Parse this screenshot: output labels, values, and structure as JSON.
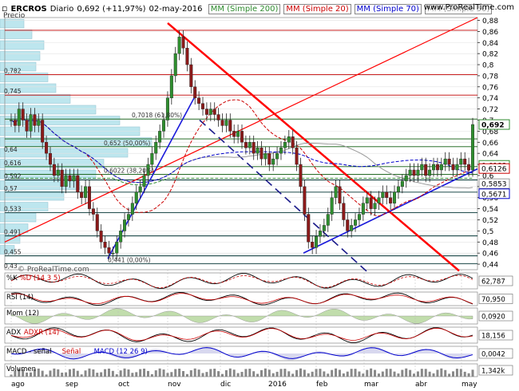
{
  "header": {
    "symbol": "ERCROS",
    "period": "Diario",
    "last": "0,692 (+11,97%)",
    "date": "02-may-2016",
    "ma200": "MM (Simple 200)",
    "ma20": "MM (Simple 20)",
    "ma70": "MM (Simple 70)",
    "ma50": "MM (Simple 50)",
    "site": "www.ProRealTime.com"
  },
  "colors": {
    "ma200": "#2e8b2e",
    "ma20": "#cc0000",
    "ma70": "#0000cc",
    "ma50": "#999999",
    "trend_red": "#ff0000",
    "trend_blue": "#1a1adb",
    "candle_up": "#2f8f2f",
    "candle_down": "#8b1a1a",
    "volume_profile": "#bde6ee"
  },
  "chart_data": {
    "type": "candlestick",
    "price_label": "Precio",
    "watermark": "© ProRealTime.com",
    "y_ticks": [
      "0,88",
      "0,86",
      "0,84",
      "0,82",
      "0,8",
      "0,78",
      "0,76",
      "0,74",
      "0,72",
      "0,7",
      "0,68",
      "0,66",
      "0,64",
      "0,62",
      "0,6",
      "0,58",
      "0,56",
      "0,54",
      "0,52",
      "0,5",
      "0,48",
      "0,46",
      "0,44"
    ],
    "ylim": [
      0.43,
      0.885
    ],
    "x_labels": [
      "ago",
      "sep",
      "oct",
      "nov",
      "dic",
      "2016",
      "feb",
      "mar",
      "abr",
      "may"
    ],
    "fib_labels": [
      {
        "text": "0,7018 (61,80%)",
        "value": 0.7018
      },
      {
        "text": "0,652 (50,00%)",
        "value": 0.652
      },
      {
        "text": "0,6022 (38,20%)",
        "value": 0.6022
      },
      {
        "text": "0,441 (0,00%)",
        "value": 0.441
      }
    ],
    "left_levels": [
      {
        "text": "0,782",
        "value": 0.782
      },
      {
        "text": "0,745",
        "value": 0.745
      },
      {
        "text": "0,64",
        "value": 0.64
      },
      {
        "text": "0,616",
        "value": 0.616
      },
      {
        "text": "0,592",
        "value": 0.592
      },
      {
        "text": "0,57",
        "value": 0.57
      },
      {
        "text": "0,533",
        "value": 0.533
      },
      {
        "text": "0,491",
        "value": 0.491
      },
      {
        "text": "0,455",
        "value": 0.455
      },
      {
        "text": "0,43",
        "value": 0.43
      }
    ],
    "horizontal_lines": [
      0.862,
      0.782,
      0.745,
      0.7018,
      0.666,
      0.652,
      0.616,
      0.6022,
      0.592,
      0.57,
      0.533,
      0.491,
      0.455,
      0.441
    ],
    "right_tags": [
      {
        "text": "0,692",
        "value": 0.692,
        "color": "#2e8b2e",
        "filled": false
      },
      {
        "text": "0,6183",
        "value": 0.6183,
        "color": "#2e8b2e",
        "filled": false
      },
      {
        "text": "0,6126",
        "value": 0.6126,
        "color": "#cc0000",
        "filled": false
      },
      {
        "text": "0,5853",
        "value": 0.5853,
        "color": "#999999",
        "filled": false
      },
      {
        "text": "0,5671",
        "value": 0.5671,
        "color": "#0000cc",
        "filled": false
      }
    ],
    "closes": [
      0.7,
      0.69,
      0.72,
      0.7,
      0.68,
      0.71,
      0.69,
      0.7,
      0.66,
      0.64,
      0.62,
      0.6,
      0.61,
      0.58,
      0.6,
      0.59,
      0.6,
      0.57,
      0.56,
      0.58,
      0.54,
      0.53,
      0.5,
      0.48,
      0.47,
      0.46,
      0.46,
      0.48,
      0.5,
      0.52,
      0.53,
      0.55,
      0.57,
      0.58,
      0.6,
      0.62,
      0.64,
      0.66,
      0.68,
      0.7,
      0.74,
      0.78,
      0.82,
      0.85,
      0.83,
      0.8,
      0.76,
      0.74,
      0.73,
      0.72,
      0.71,
      0.72,
      0.71,
      0.7,
      0.69,
      0.7,
      0.68,
      0.67,
      0.68,
      0.66,
      0.65,
      0.66,
      0.64,
      0.65,
      0.63,
      0.64,
      0.62,
      0.63,
      0.64,
      0.65,
      0.66,
      0.67,
      0.65,
      0.62,
      0.58,
      0.53,
      0.48,
      0.47,
      0.49,
      0.5,
      0.51,
      0.53,
      0.56,
      0.58,
      0.55,
      0.52,
      0.5,
      0.51,
      0.52,
      0.53,
      0.55,
      0.56,
      0.54,
      0.55,
      0.56,
      0.57,
      0.56,
      0.55,
      0.57,
      0.58,
      0.59,
      0.6,
      0.61,
      0.6,
      0.61,
      0.62,
      0.6,
      0.61,
      0.62,
      0.61,
      0.62,
      0.63,
      0.62,
      0.61,
      0.62,
      0.63,
      0.62,
      0.61,
      0.692
    ],
    "indicators": [
      {
        "name": "%K",
        "label2": "%D (14 3 5)",
        "value": "62,787"
      },
      {
        "name": "RSI (14)",
        "value": "70,950"
      },
      {
        "name": "Mom (12)",
        "value": "0,0920"
      },
      {
        "name": "ADX",
        "label2": "ADXR (14)",
        "value": "18,156"
      },
      {
        "name": "MACD - señal",
        "label2": "Señal",
        "label3": "MACD (12 26 9)",
        "value": "0,0042"
      },
      {
        "name": "Volumen",
        "value": "1,342k"
      }
    ]
  }
}
